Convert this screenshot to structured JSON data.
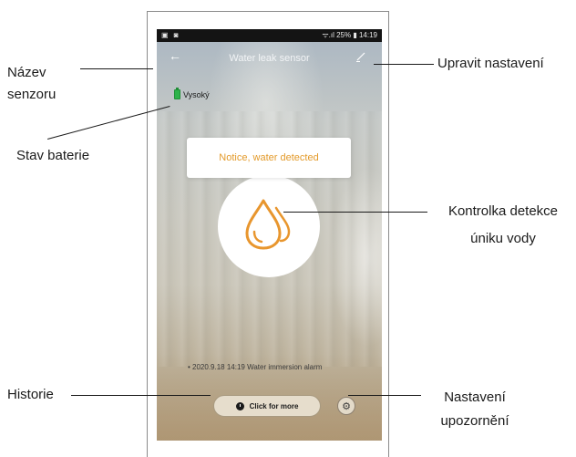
{
  "status_bar": {
    "left_icons": "▣ ◙",
    "right_text": "ᯤ.ıl 25% ▮ 14:19"
  },
  "app_bar": {
    "title": "Water leak sensor"
  },
  "battery": {
    "label": "Vysoký",
    "color": "#2db34a"
  },
  "notice": {
    "text": "Notice, water detected",
    "color": "#e39a2a"
  },
  "history": {
    "entry": "• 2020.9.18 14:19 Water immersion alarm"
  },
  "buttons": {
    "more_label": "Click for more"
  },
  "callouts": {
    "sensor_name": [
      "Název",
      "senzoru"
    ],
    "battery_status": "Stav baterie",
    "history": "Historie",
    "edit_settings": "Upravit nastavení",
    "leak_indicator": [
      "Kontrolka detekce",
      "úniku vody"
    ],
    "alert_settings": [
      "Nastavení",
      "upozornění"
    ]
  }
}
